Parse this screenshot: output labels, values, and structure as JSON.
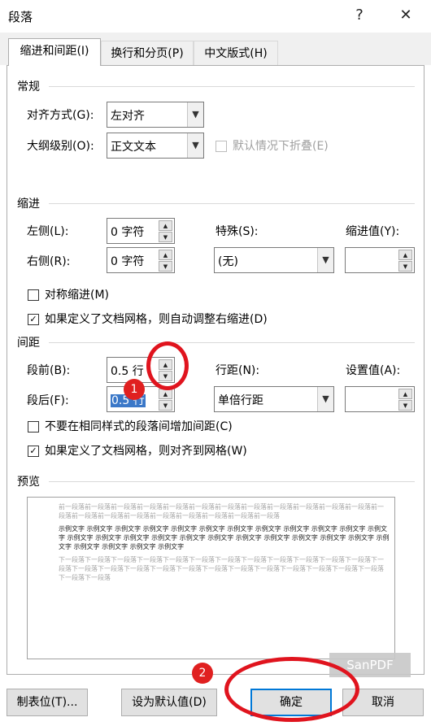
{
  "window": {
    "title": "段落",
    "help": "?",
    "close": "✕"
  },
  "tabs": [
    {
      "label": "缩进和间距(I)"
    },
    {
      "label": "换行和分页(P)"
    },
    {
      "label": "中文版式(H)"
    }
  ],
  "general": {
    "title": "常规",
    "align_label": "对齐方式(G):",
    "align_value": "左对齐",
    "outline_label": "大纲级别(O):",
    "outline_value": "正文文本",
    "collapse_label": "默认情况下折叠(E)"
  },
  "indent": {
    "title": "缩进",
    "left_label": "左侧(L):",
    "left_value": "0 字符",
    "right_label": "右侧(R):",
    "right_value": "0 字符",
    "special_label": "特殊(S):",
    "special_value": "(无)",
    "by_label": "缩进值(Y):",
    "mirror_label": "对称缩进(M)",
    "grid_label": "如果定义了文档网格，则自动调整右缩进(D)"
  },
  "spacing": {
    "title": "间距",
    "before_label": "段前(B):",
    "before_value": "0.5 行",
    "after_label": "段后(F):",
    "after_value": "0.5 行",
    "line_label": "行距(N):",
    "line_value": "单倍行距",
    "at_label": "设置值(A):",
    "nospace_label": "不要在相同样式的段落间增加间距(C)",
    "snap_label": "如果定义了文档网格，则对齐到网格(W)"
  },
  "preview": {
    "title": "预览",
    "prev_text": "前一段落前一段落前一段落前一段落前一段落前一段落前一段落前一段落前一段落前一段落前一段落前一段落前一段落前一段落前一段落前一段落前一段落前一段落前一段落前一段落前一段落",
    "sample_text": "示例文字 示例文字 示例文字 示例文字 示例文字 示例文字 示例文字 示例文字 示例文字 示例文字 示例文字 示例文字 示例文字 示例文字 示例文字 示例文字 示例文字 示例文字 示例文字 示例文字 示例文字 示例文字 示例文字 示例文字 示例文字 示例文字 示例文字 示例文字",
    "next_text": "下一段落下一段落下一段落下一段落下一段落下一段落下一段落下一段落下一段落下一段落下一段落下一段落下一段落下一段落下一段落下一段落下一段落下一段落下一段落下一段落下一段落下一段落下一段落下一段落下一段落下一段落下一段落"
  },
  "buttons": {
    "tabs": "制表位(T)...",
    "default": "设为默认值(D)",
    "ok": "确定",
    "cancel": "取消"
  },
  "annotations": {
    "badge1": "1",
    "badge2": "2",
    "watermark": "SanPDF"
  }
}
